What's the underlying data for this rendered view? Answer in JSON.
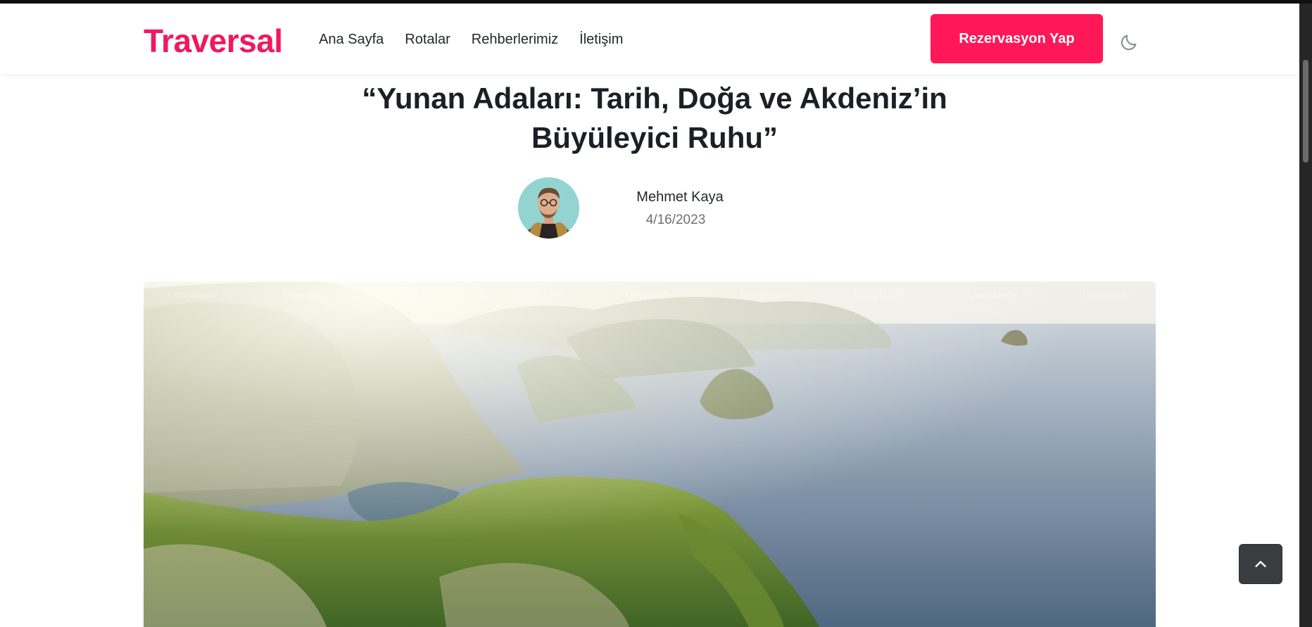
{
  "header": {
    "logo": "Traversal",
    "nav": [
      "Ana Sayfa",
      "Rotalar",
      "Rehberlerimiz",
      "İletişim"
    ],
    "cta_label": "Rezervasyon Yap",
    "theme_icon": "moon-icon"
  },
  "article": {
    "title_line1": "“Yunan Adaları: Tarih, Doğa ve Akdeniz’in",
    "title_line2": "Büyüleyici Ruhu”",
    "author": "Mehmet Kaya",
    "date": "4/16/2023",
    "hero_watermark": "Unsplash+"
  },
  "controls": {
    "scroll_top_icon": "chevron-up-icon"
  },
  "colors": {
    "brand": "#f0185f",
    "cta": "#ff1757",
    "text": "#1f2126"
  }
}
